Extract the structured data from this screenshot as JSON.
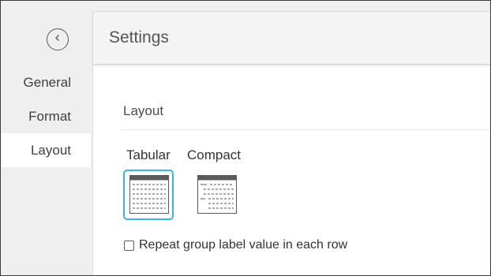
{
  "sidebar": {
    "back_icon": "chevron-left-icon",
    "items": [
      {
        "label": "General",
        "active": false
      },
      {
        "label": "Format",
        "active": false
      },
      {
        "label": "Layout",
        "active": true
      }
    ]
  },
  "panel": {
    "title": "Settings",
    "section_title": "Layout",
    "options": [
      {
        "label": "Tabular",
        "icon": "tabular-layout-icon",
        "selected": true
      },
      {
        "label": "Compact",
        "icon": "compact-layout-icon",
        "selected": false
      }
    ],
    "repeat_checkbox": {
      "label": "Repeat group label value in each row",
      "checked": false
    }
  },
  "colors": {
    "selected_border": "#35b6e6",
    "sidebar_bg": "#efefef",
    "header_bg": "#f4f4f4",
    "icon_header": "#5a5a5a"
  }
}
